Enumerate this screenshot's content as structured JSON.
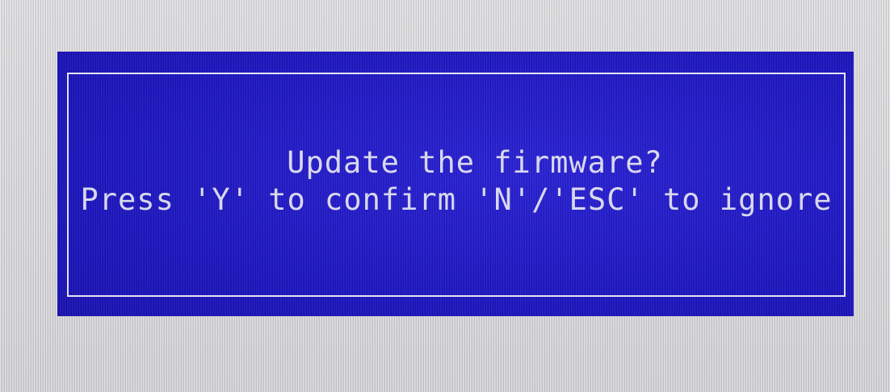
{
  "dialog": {
    "title": "Update the firmware?",
    "prompt": "Press 'Y' to confirm 'N'/'ESC' to ignore"
  },
  "colors": {
    "dialog_background": "#1f17c6",
    "text": "#e6e6f0",
    "border": "#e4e4f4",
    "screen_background": "#d6d6d8"
  }
}
